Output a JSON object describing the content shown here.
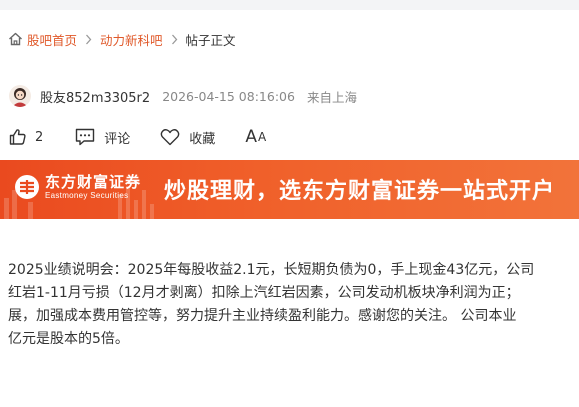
{
  "breadcrumb": {
    "home": "股吧首页",
    "forum": "动力新科吧",
    "current": "帖子正文"
  },
  "author": {
    "name": "股友852m3305r2",
    "time": "2026-04-15 08:16:06",
    "location": "来自上海"
  },
  "actions": {
    "like_count": "2",
    "comment_label": "评论",
    "favorite_label": "收藏",
    "font_big": "A",
    "font_small": "A"
  },
  "banner": {
    "logo_cn": "东方财富证券",
    "logo_en": "Eastmoney Securities",
    "slogan": "炒股理财，选东方财富证券一站式开户"
  },
  "post": {
    "lines": [
      "2025业绩说明会：2025年每股收益2.1元，长短期负债为0，手上现金43亿元，公司",
      "红岩1-11月亏损（12月才剥离）扣除上汽红岩因素，公司发动机板块净利润为正；",
      "展，加强成本费用管控等，努力提升主业持续盈利能力。感谢您的关注。 公司本业",
      "亿元是股本的5倍。"
    ]
  },
  "colors": {
    "accent": "#e0592a",
    "banner": "#ee5526",
    "text": "#333333",
    "muted": "#888888"
  }
}
